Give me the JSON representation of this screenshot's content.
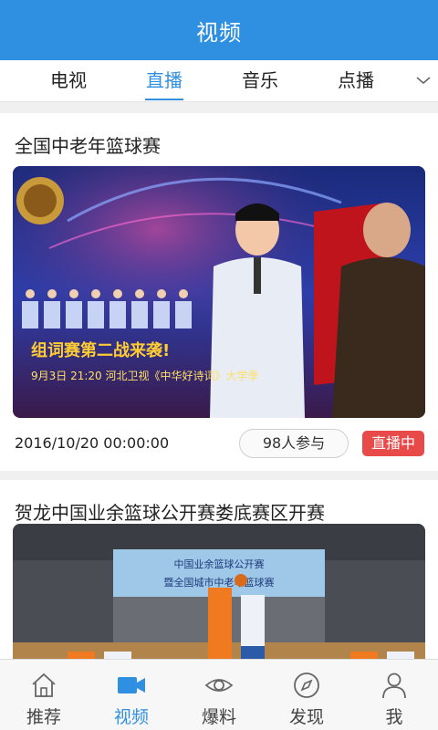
{
  "header": {
    "title": "视频"
  },
  "tabs": [
    {
      "label": "电视"
    },
    {
      "label": "直播"
    },
    {
      "label": "音乐"
    },
    {
      "label": "点播"
    }
  ],
  "active_tab": "直播",
  "feed": [
    {
      "title": "全国中老年篮球赛",
      "time": "2016/10/20 00:00:00",
      "participants": "98人参与",
      "badge": "直播中",
      "thumbnail": {
        "caption1": "组词赛第二战来袭!",
        "caption2": "9月3日 21:20 河北卫视《中华好诗词》大学季"
      }
    },
    {
      "title": "贺龙中国业余篮球公开赛娄底赛区开赛",
      "thumbnail": {
        "banner1": "中国业余篮球公开赛",
        "banner2": "暨全国城市中老年篮球赛"
      }
    }
  ],
  "bottom_nav": [
    {
      "label": "推荐",
      "icon": "home-icon"
    },
    {
      "label": "视频",
      "icon": "video-camera-icon"
    },
    {
      "label": "爆料",
      "icon": "eye-icon"
    },
    {
      "label": "发现",
      "icon": "compass-icon"
    },
    {
      "label": "我",
      "icon": "person-icon"
    }
  ],
  "colors": {
    "primary": "#2f8fe0",
    "live_badge": "#e84a4a"
  }
}
